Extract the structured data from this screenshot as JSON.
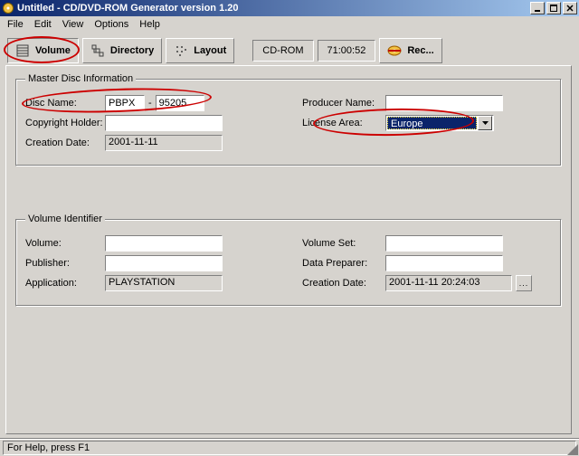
{
  "window": {
    "title": "Untitled - CD/DVD-ROM Generator version 1.20"
  },
  "menu": {
    "file": "File",
    "edit": "Edit",
    "view": "View",
    "options": "Options",
    "help": "Help"
  },
  "toolbar": {
    "volume": "Volume",
    "directory": "Directory",
    "layout": "Layout",
    "cdrom": "CD-ROM",
    "time": "71:00:52",
    "rec": "Rec..."
  },
  "master": {
    "legend": "Master Disc Information",
    "disc_name_label": "Disc Name:",
    "disc_name_prefix": "PBPX",
    "disc_name_sep": "-",
    "disc_name_num": "95205",
    "copyright_label": "Copyright Holder:",
    "copyright_value": "",
    "creation_label": "Creation Date:",
    "creation_value": "2001-11-11",
    "producer_label": "Producer Name:",
    "producer_value": "",
    "license_label": "License Area:",
    "license_value": "Europe"
  },
  "volume": {
    "legend": "Volume Identifier",
    "volume_label": "Volume:",
    "volume_value": "",
    "publisher_label": "Publisher:",
    "publisher_value": "",
    "application_label": "Application:",
    "application_value": "PLAYSTATION",
    "volumeset_label": "Volume Set:",
    "volumeset_value": "",
    "preparer_label": "Data Preparer:",
    "preparer_value": "",
    "creation_label": "Creation Date:",
    "creation_value": "2001-11-11 20:24:03"
  },
  "status": {
    "text": "For Help, press F1"
  }
}
